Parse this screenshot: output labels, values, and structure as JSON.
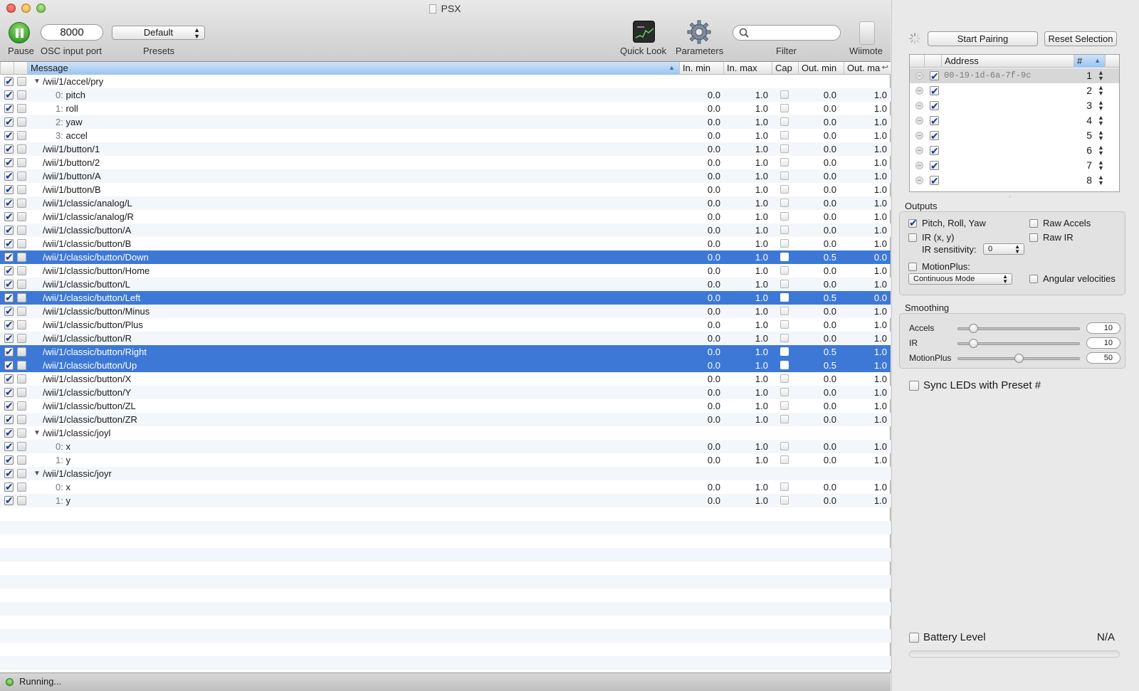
{
  "window": {
    "title": "PSX"
  },
  "toolbar": {
    "pause_label": "Pause",
    "port_value": "8000",
    "port_label": "OSC input port",
    "preset_value": "Default",
    "preset_label": "Presets",
    "quicklook_label": "Quick Look",
    "parameters_label": "Parameters",
    "filter_label": "Filter",
    "filter_value": "",
    "wiimote_label": "Wiimote"
  },
  "table": {
    "columns": [
      "Message",
      "In. min",
      "In. max",
      "Cap",
      "Out. min",
      "Out. ma"
    ],
    "rows": [
      {
        "msg": "/wii/1/accel/pry",
        "group": true
      },
      {
        "idx": "0:",
        "msg": "pitch",
        "inmin": "0.0",
        "inmax": "1.0",
        "outmin": "0.0",
        "outmax": "1.0"
      },
      {
        "idx": "1:",
        "msg": "roll",
        "inmin": "0.0",
        "inmax": "1.0",
        "outmin": "0.0",
        "outmax": "1.0"
      },
      {
        "idx": "2:",
        "msg": "yaw",
        "inmin": "0.0",
        "inmax": "1.0",
        "outmin": "0.0",
        "outmax": "1.0"
      },
      {
        "idx": "3:",
        "msg": "accel",
        "inmin": "0.0",
        "inmax": "1.0",
        "outmin": "0.0",
        "outmax": "1.0"
      },
      {
        "msg": "/wii/1/button/1",
        "inmin": "0.0",
        "inmax": "1.0",
        "outmin": "0.0",
        "outmax": "1.0"
      },
      {
        "msg": "/wii/1/button/2",
        "inmin": "0.0",
        "inmax": "1.0",
        "outmin": "0.0",
        "outmax": "1.0"
      },
      {
        "msg": "/wii/1/button/A",
        "inmin": "0.0",
        "inmax": "1.0",
        "outmin": "0.0",
        "outmax": "1.0"
      },
      {
        "msg": "/wii/1/button/B",
        "inmin": "0.0",
        "inmax": "1.0",
        "outmin": "0.0",
        "outmax": "1.0"
      },
      {
        "msg": "/wii/1/classic/analog/L",
        "inmin": "0.0",
        "inmax": "1.0",
        "outmin": "0.0",
        "outmax": "1.0"
      },
      {
        "msg": "/wii/1/classic/analog/R",
        "inmin": "0.0",
        "inmax": "1.0",
        "outmin": "0.0",
        "outmax": "1.0"
      },
      {
        "msg": "/wii/1/classic/button/A",
        "inmin": "0.0",
        "inmax": "1.0",
        "outmin": "0.0",
        "outmax": "1.0"
      },
      {
        "msg": "/wii/1/classic/button/B",
        "inmin": "0.0",
        "inmax": "1.0",
        "outmin": "0.0",
        "outmax": "1.0"
      },
      {
        "msg": "/wii/1/classic/button/Down",
        "inmin": "0.0",
        "inmax": "1.0",
        "outmin": "0.5",
        "outmax": "0.0",
        "selected": true
      },
      {
        "msg": "/wii/1/classic/button/Home",
        "inmin": "0.0",
        "inmax": "1.0",
        "outmin": "0.0",
        "outmax": "1.0"
      },
      {
        "msg": "/wii/1/classic/button/L",
        "inmin": "0.0",
        "inmax": "1.0",
        "outmin": "0.0",
        "outmax": "1.0"
      },
      {
        "msg": "/wii/1/classic/button/Left",
        "inmin": "0.0",
        "inmax": "1.0",
        "outmin": "0.5",
        "outmax": "0.0",
        "selected": true
      },
      {
        "msg": "/wii/1/classic/button/Minus",
        "inmin": "0.0",
        "inmax": "1.0",
        "outmin": "0.0",
        "outmax": "1.0"
      },
      {
        "msg": "/wii/1/classic/button/Plus",
        "inmin": "0.0",
        "inmax": "1.0",
        "outmin": "0.0",
        "outmax": "1.0"
      },
      {
        "msg": "/wii/1/classic/button/R",
        "inmin": "0.0",
        "inmax": "1.0",
        "outmin": "0.0",
        "outmax": "1.0"
      },
      {
        "msg": "/wii/1/classic/button/Right",
        "inmin": "0.0",
        "inmax": "1.0",
        "outmin": "0.5",
        "outmax": "1.0",
        "selected": true
      },
      {
        "msg": "/wii/1/classic/button/Up",
        "inmin": "0.0",
        "inmax": "1.0",
        "outmin": "0.5",
        "outmax": "1.0",
        "selected": true
      },
      {
        "msg": "/wii/1/classic/button/X",
        "inmin": "0.0",
        "inmax": "1.0",
        "outmin": "0.0",
        "outmax": "1.0"
      },
      {
        "msg": "/wii/1/classic/button/Y",
        "inmin": "0.0",
        "inmax": "1.0",
        "outmin": "0.0",
        "outmax": "1.0"
      },
      {
        "msg": "/wii/1/classic/button/ZL",
        "inmin": "0.0",
        "inmax": "1.0",
        "outmin": "0.0",
        "outmax": "1.0"
      },
      {
        "msg": "/wii/1/classic/button/ZR",
        "inmin": "0.0",
        "inmax": "1.0",
        "outmin": "0.0",
        "outmax": "1.0"
      },
      {
        "msg": "/wii/1/classic/joyl",
        "group": true
      },
      {
        "idx": "0:",
        "msg": "x",
        "inmin": "0.0",
        "inmax": "1.0",
        "outmin": "0.0",
        "outmax": "1.0"
      },
      {
        "idx": "1:",
        "msg": "y",
        "inmin": "0.0",
        "inmax": "1.0",
        "outmin": "0.0",
        "outmax": "1.0"
      },
      {
        "msg": "/wii/1/classic/joyr",
        "group": true
      },
      {
        "idx": "0:",
        "msg": "x",
        "inmin": "0.0",
        "inmax": "1.0",
        "outmin": "0.0",
        "outmax": "1.0"
      },
      {
        "idx": "1:",
        "msg": "y",
        "inmin": "0.0",
        "inmax": "1.0",
        "outmin": "0.0",
        "outmax": "1.0"
      }
    ]
  },
  "status": {
    "text": "Running..."
  },
  "drawer": {
    "start_pairing": "Start Pairing",
    "reset_selection": "Reset Selection",
    "wiimote_table": {
      "address_header": "Address",
      "num_header": "#",
      "rows": [
        {
          "address": "00-19-1d-6a-7f-9c",
          "num": "1"
        },
        {
          "address": "",
          "num": "2"
        },
        {
          "address": "",
          "num": "3"
        },
        {
          "address": "",
          "num": "4"
        },
        {
          "address": "",
          "num": "5"
        },
        {
          "address": "",
          "num": "6"
        },
        {
          "address": "",
          "num": "7"
        },
        {
          "address": "",
          "num": "8"
        }
      ]
    },
    "outputs": {
      "title": "Outputs",
      "pitch_roll_yaw": "Pitch, Roll, Yaw",
      "raw_accels": "Raw Accels",
      "ir_xy": "IR (x, y)",
      "raw_ir": "Raw IR",
      "ir_sensitivity_label": "IR sensitivity:",
      "ir_sensitivity_value": "0",
      "motionplus": "MotionPlus:",
      "mode_value": "Continuous Mode",
      "angular_velocities": "Angular velocities"
    },
    "smoothing": {
      "title": "Smoothing",
      "accels_label": "Accels",
      "accels_value": "10",
      "accels_level": 0.1,
      "ir_label": "IR",
      "ir_value": "10",
      "ir_level": 0.1,
      "motionplus_label": "MotionPlus",
      "motionplus_value": "50",
      "motionplus_level": 0.5
    },
    "sync_leds": "Sync LEDs with Preset #",
    "battery_label": "Battery Level",
    "battery_value": "N/A"
  }
}
